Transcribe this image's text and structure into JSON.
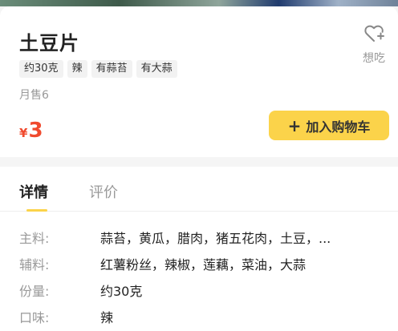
{
  "product": {
    "name": "土豆片",
    "favorite_label": "想吃",
    "tags": [
      "约30克",
      "辣",
      "有蒜苔",
      "有大蒜"
    ],
    "sales": "月售6",
    "price_currency": "¥",
    "price_amount": "3",
    "add_to_cart_label": "加入购物车",
    "add_to_cart_plus": "+"
  },
  "tabs": [
    {
      "label": "详情",
      "active": true
    },
    {
      "label": "评价",
      "active": false
    }
  ],
  "details": [
    {
      "key": "主料:",
      "value": "蒜苔，黄瓜，腊肉，猪五花肉，土豆，..."
    },
    {
      "key": "辅料:",
      "value": "红薯粉丝，辣椒，莲藕，菜油，大蒜"
    },
    {
      "key": "份量:",
      "value": "约30克"
    },
    {
      "key": "口味:",
      "value": "辣"
    }
  ],
  "colors": {
    "accent": "#fbd34a",
    "price": "#f04a2e"
  },
  "icons": {
    "favorite": "heart-plus-icon"
  }
}
